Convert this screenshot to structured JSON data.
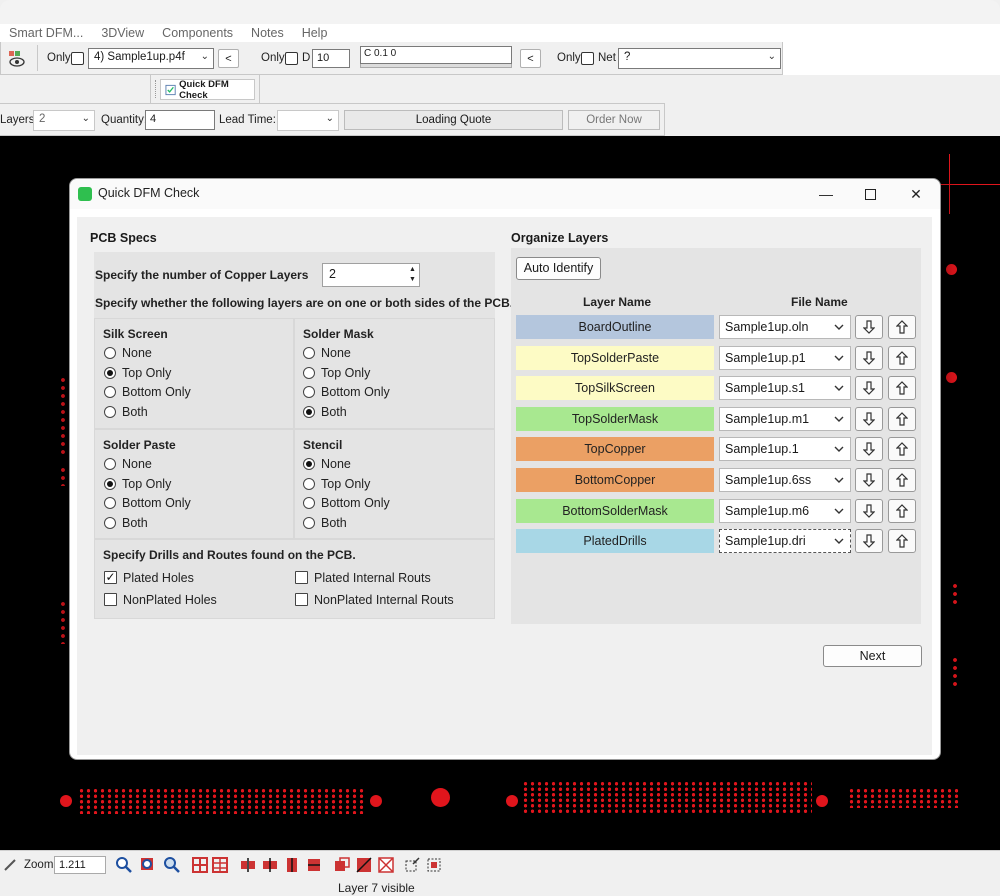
{
  "app": {
    "menu": [
      "Smart DFM...",
      "3DView",
      "Components",
      "Notes",
      "Help"
    ]
  },
  "toolbar": {
    "only1_label": "Only",
    "file_select": "4) Sample1up.p4f",
    "only2_label": "Only",
    "d_label": "D",
    "d_value": "10",
    "coord_value": "C 0.1  0",
    "only3_label": "Only",
    "net_label": "Net",
    "net_value": "?",
    "dfm_button": "Quick DFM Check",
    "layers_label": "Layers:",
    "layers_value": "2",
    "quantity_label": "Quantity:",
    "quantity_value": "4",
    "lead_time_label": "Lead Time:",
    "lead_time_value": "",
    "loading_quote": "Loading Quote",
    "order_now": "Order Now"
  },
  "status": {
    "zoom_label": "Zoom:",
    "zoom_value": "1.211",
    "status_text": "Layer 7 visible"
  },
  "dialog": {
    "title": "Quick DFM Check",
    "pcb_specs": {
      "heading": "PCB Specs",
      "copper_label": "Specify the number of Copper Layers",
      "copper_value": "2",
      "sides_label": "Specify whether the following layers are on one or both sides of the PCB.",
      "groups": [
        {
          "title": "Silk Screen",
          "options": [
            "None",
            "Top Only",
            "Bottom Only",
            "Both"
          ],
          "selected": "Top Only"
        },
        {
          "title": "Solder Mask",
          "options": [
            "None",
            "Top Only",
            "Bottom Only",
            "Both"
          ],
          "selected": "Both"
        },
        {
          "title": "Solder Paste",
          "options": [
            "None",
            "Top Only",
            "Bottom Only",
            "Both"
          ],
          "selected": "Top Only"
        },
        {
          "title": "Stencil",
          "options": [
            "None",
            "Top Only",
            "Bottom Only",
            "Both"
          ],
          "selected": "None"
        }
      ],
      "drills_label": "Specify Drills and Routes found on the PCB.",
      "drills": [
        {
          "label": "Plated Holes",
          "checked": true
        },
        {
          "label": "Plated Internal Routs",
          "checked": false
        },
        {
          "label": "NonPlated Holes",
          "checked": false
        },
        {
          "label": "NonPlated Internal Routs",
          "checked": false
        }
      ]
    },
    "organize": {
      "heading": "Organize Layers",
      "auto_identify": "Auto Identify",
      "col_layer": "Layer Name",
      "col_file": "File Name",
      "rows": [
        {
          "layer": "BoardOutline",
          "file": "Sample1up.oln",
          "color": "#b4c6dd"
        },
        {
          "layer": "TopSolderPaste",
          "file": "Sample1up.p1",
          "color": "#fdfbc5"
        },
        {
          "layer": "TopSilkScreen",
          "file": "Sample1up.s1",
          "color": "#fdfbc5"
        },
        {
          "layer": "TopSolderMask",
          "file": "Sample1up.m1",
          "color": "#a8e890"
        },
        {
          "layer": "TopCopper",
          "file": "Sample1up.1",
          "color": "#eba064"
        },
        {
          "layer": "BottomCopper",
          "file": "Sample1up.6ss",
          "color": "#eba064"
        },
        {
          "layer": "BottomSolderMask",
          "file": "Sample1up.m6",
          "color": "#a8e890"
        },
        {
          "layer": "PlatedDrills",
          "file": "Sample1up.dri",
          "color": "#a8d7e6"
        }
      ]
    },
    "next_button": "Next"
  }
}
